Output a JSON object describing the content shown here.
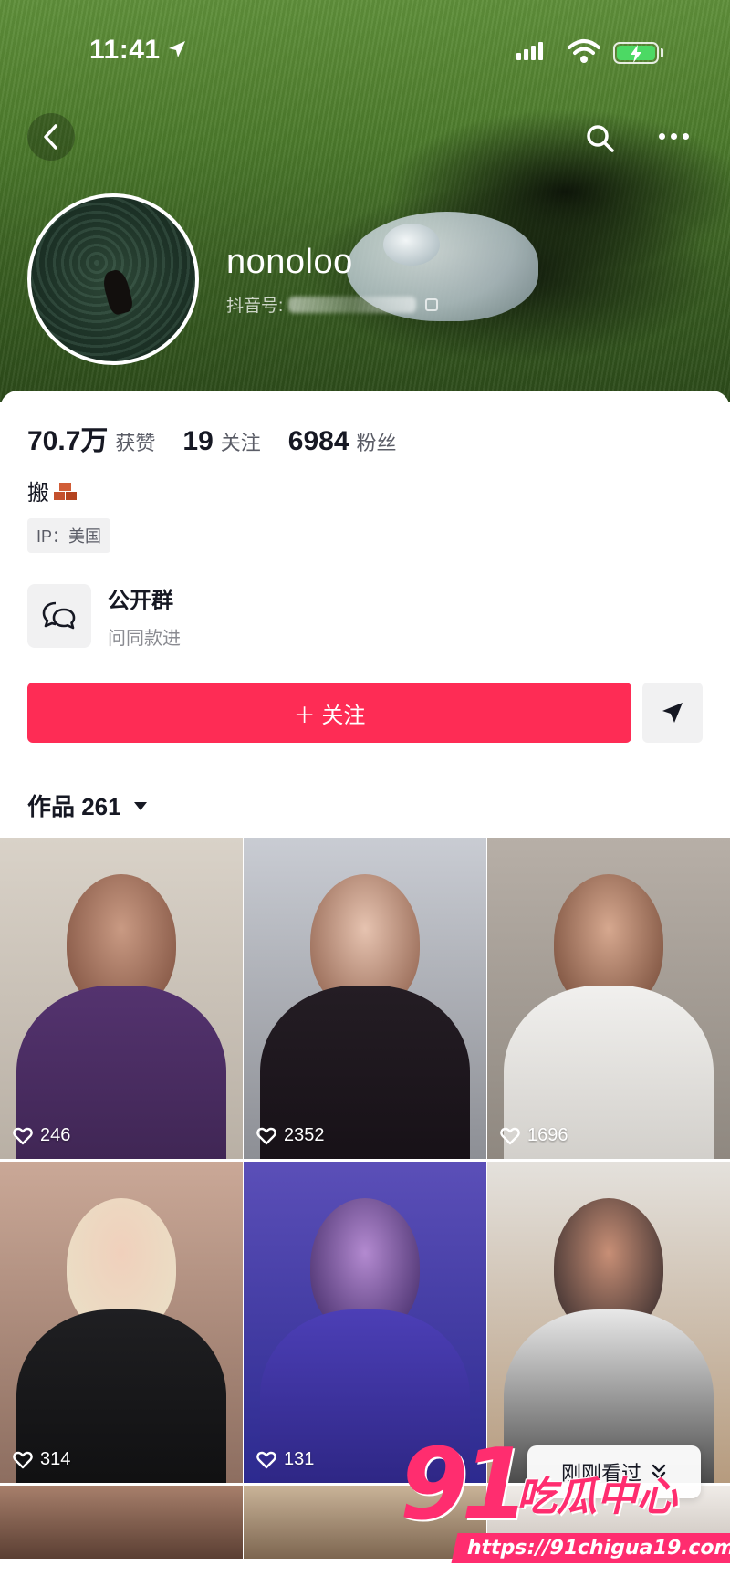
{
  "status_bar": {
    "time": "11:41"
  },
  "profile": {
    "username": "nonoloo",
    "douyin_id_label": "抖音号:",
    "stats": [
      {
        "value": "70.7万",
        "label": "获赞"
      },
      {
        "value": "19",
        "label": "关注"
      },
      {
        "value": "6984",
        "label": "粉丝"
      }
    ],
    "bio": "搬",
    "ip_tag": "IP：美国"
  },
  "group": {
    "title": "公开群",
    "subtitle": "问同款进"
  },
  "actions": {
    "follow_label": "＋ 关注"
  },
  "works_tab": {
    "label": "作品 261"
  },
  "videos": [
    {
      "likes": "246"
    },
    {
      "likes": "2352"
    },
    {
      "likes": "1696"
    },
    {
      "likes": "314"
    },
    {
      "likes": "131"
    },
    {
      "likes": ""
    }
  ],
  "recent_pill": {
    "label": "刚刚看过"
  },
  "watermark": {
    "logo_number": "91",
    "logo_text": "吃瓜中心",
    "url": "https://91chigua19.com"
  },
  "colors": {
    "accent": "#fe2c55",
    "watermark": "#ff2d6f"
  }
}
